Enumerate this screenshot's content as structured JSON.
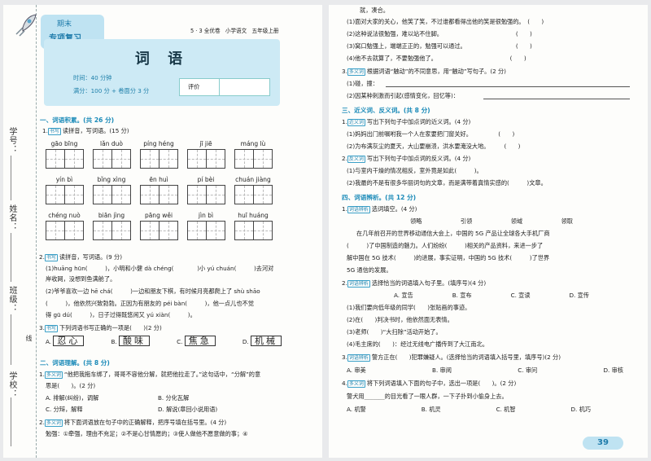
{
  "header": {
    "badge_line1": "期末",
    "badge_line2": "专项复习",
    "book": "5 · 3 全优卷",
    "subject": "小学语文",
    "grade": "五年级上册",
    "title": "词 语",
    "time": "时间：40 分钟",
    "score": "满分：100 分 + 卷面分 3 分",
    "eval": "评价"
  },
  "binding": {
    "school": "学校：",
    "class": "班级：",
    "name": "姓名：",
    "id": "学号：",
    "cut": "线"
  },
  "left": {
    "s1": "一、词语积累。(共 26 分)",
    "q1_tag": "书写",
    "q1": "读拼音，写词语。(15 分)",
    "pinyin_row1": [
      "gāo bīng",
      "lǎn duò",
      "píng héng",
      "jī jiē",
      "máng lù"
    ],
    "pinyin_row2": [
      "yín bì",
      "bǐng xìng",
      "ēn huì",
      "pí bèi",
      "chuán jiàng"
    ],
    "pinyin_row3": [
      "chéng nuò",
      "biān jìng",
      "pāng wěi",
      "jìn bì",
      "huī huáng"
    ],
    "q2_num": "2.",
    "q2_tag": "书写",
    "q2": "读拼音，写词语。(9 分)",
    "q2_l1": "(1)huāng hūn(　　　)，小明和小健 dà chéng(　　　　)小 yú chuán(　　　)去河对",
    "q2_l2": "岸收网，没想到鱼满舱了。",
    "q2_l3": "(2)爷爷喜欢一边 hē chá(　　　)一边和朋友下棋，有时候月亮都爬上了 shù shāo",
    "q2_l4": "(　　　)，他依然兴致勃勃。正因为有朋友的 péi bàn(　　　)，他一点儿也不觉",
    "q2_l5": "得 gū dú(　　　)，日子过得既悠闲又 yú xiàn(　　　)。",
    "q3_num": "3.",
    "q3_tag": "书写",
    "q3": "下列词语书写正确的一项是(　　)(2 分)",
    "q3_opts": [
      {
        "label": "A.",
        "word": "忍心"
      },
      {
        "label": "B.",
        "word": "酸味"
      },
      {
        "label": "C.",
        "word": "焦急"
      },
      {
        "label": "D.",
        "word": "机械"
      }
    ],
    "s2": "二、词语理解。(共 8 分)",
    "q4_num": "1.",
    "q4_tag": "多义词",
    "q4_l1": "“他把我拖车绑了，哥哥不容他分解，就把他拉走了。”这句话中，“分解”的意",
    "q4_l2": "思是(　　)。(2 分)",
    "q4_opts": [
      "A. 排解(纠纷)，调解",
      "B. 分化瓦解",
      "C. 分辩，解释",
      "D. 解说(章回小说用语)"
    ],
    "q5_num": "2.",
    "q5_tag": "多义词",
    "q5": "将下面词语放在句子中的正确解释，把序号填在括号里。(4 分)",
    "q5_l1": "勉强：①牵强，理由不充足；②不是心甘情愿的；③使人做他不愿意做的事；④"
  },
  "right": {
    "r_l0": "就，凑合。",
    "r_items": [
      "(1)面对大家的关心，他笑了笑，不过谁都看得出他的笑是很勉强的。　(　　)",
      "(2)这种说法很勉强，难以站不住脚。　　　　　　　　　　　　　(　　)",
      "(3)窝口勉强上，端端正正的，勉强可以通过。　　　　　　　　　(　　)",
      "(4)他不去就算了，不要勉强他了。　　　　　　　　　　　　　(　　)"
    ],
    "q3_num": "3.",
    "q3_tag": "多义词",
    "q3": "根据词语“触动”的不同意思，用“触动”写句子。(2 分)",
    "q3_a": "(1)碰，撞：",
    "q3_b": "(2)因某种刺激而引起(感情变化，回忆等)：",
    "s3": "三、近义词、反义词。(共 8 分)",
    "q1_num": "1.",
    "q1_tag": "近义词",
    "q1": "写出下列句子中加点词的近义词。(4 分)",
    "q1_a": "(1)妈妈出门前嘱咐我一个人在家要把门窗关好。　　　　　(　　)",
    "q1_b": "(2)为布满灰尘的夏天，大山要崩溃，洪水要淹没大地。　　　(　　)",
    "q2_num": "2.",
    "q2_tag": "反义词",
    "q2": "写出下列句子中加点词的反义词。(4 分)",
    "q2_a": "(1)与室内干燥的情况相反，室外竟是如此(　　　)。",
    "q2_b": "(2)我最的不是有很多华丽词句的文章，而是满带着真情实感的(　　　)文章。",
    "s4": "四、词语辨析。(共 12 分)",
    "p1_num": "1.",
    "p1_tag": "词语辨析",
    "p1": "选词填空。(4 分)",
    "choices": [
      "领略",
      "引领",
      "领域",
      "领取"
    ],
    "para": [
      "在几年前召开的世界移动通信大会上，中国的 5G 产品让全球各大手机厂商",
      "(　　　)了中国制造的魅力。人们纷纷(　　　)相关的产品资料，来进一步了",
      "解中国在 5G 技术(　　　)的进展，事实证明，中国的 5G 技术(　　　)了世界",
      "5G 通信的发展。"
    ],
    "p2_num": "2.",
    "p2_tag": "词语辨析",
    "p2": "选择恰当的词语填入句子里。(填序号)(4 分)",
    "p2_opts": [
      "A. 宣告",
      "B. 宣布",
      "C. 宣读",
      "D. 宣传"
    ],
    "p2_items": [
      "(1)我们要向低年级的同学(　　)张贴画的事迹。",
      "(2)在(　　)判决书时，他依然面无表情。",
      "(3)老师(　　)“大扫除”活动开始了。",
      "(4)毛主席的(　　)：经过无线电广播传到了大江南北。"
    ],
    "p3_num": "3.",
    "p3_tag": "词语辨析",
    "p3": "警方正在(　　)犯罪嫌疑人。(选择恰当的词语填入括号里，填序号)(2 分)",
    "p3_opts": [
      "A. 审美",
      "B. 审阅",
      "C. 审问",
      "D. 审核"
    ],
    "p4_num": "4.",
    "p4_tag": "多义词",
    "p4": "将下列词语填入下面的句子中，选出一项是(　　)。(2 分)",
    "p4_l": "警犬用_______的目光看了一眼人群，一下子扑到小偷身上去。",
    "p4_opts": [
      "A. 机警",
      "B. 机灵",
      "C. 机智",
      "D. 机巧"
    ],
    "page_no": "39"
  }
}
